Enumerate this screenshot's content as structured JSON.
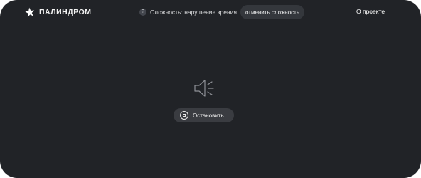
{
  "header": {
    "logo_text": "ПАЛИНДРОМ",
    "logo_icon": "star-icon",
    "hint_icon": "question-icon",
    "hint_icon_glyph": "?",
    "difficulty_text": "Сложность: нарушение зрения",
    "cancel_label": "отменить сложность",
    "about_label": "О проекте"
  },
  "main": {
    "speaker_icon": "speaker-icon",
    "stop_icon": "stop-icon",
    "stop_label": "Остановить"
  },
  "colors": {
    "background": "#212327",
    "button_bg": "#3a3c41",
    "text": "#ffffff"
  }
}
